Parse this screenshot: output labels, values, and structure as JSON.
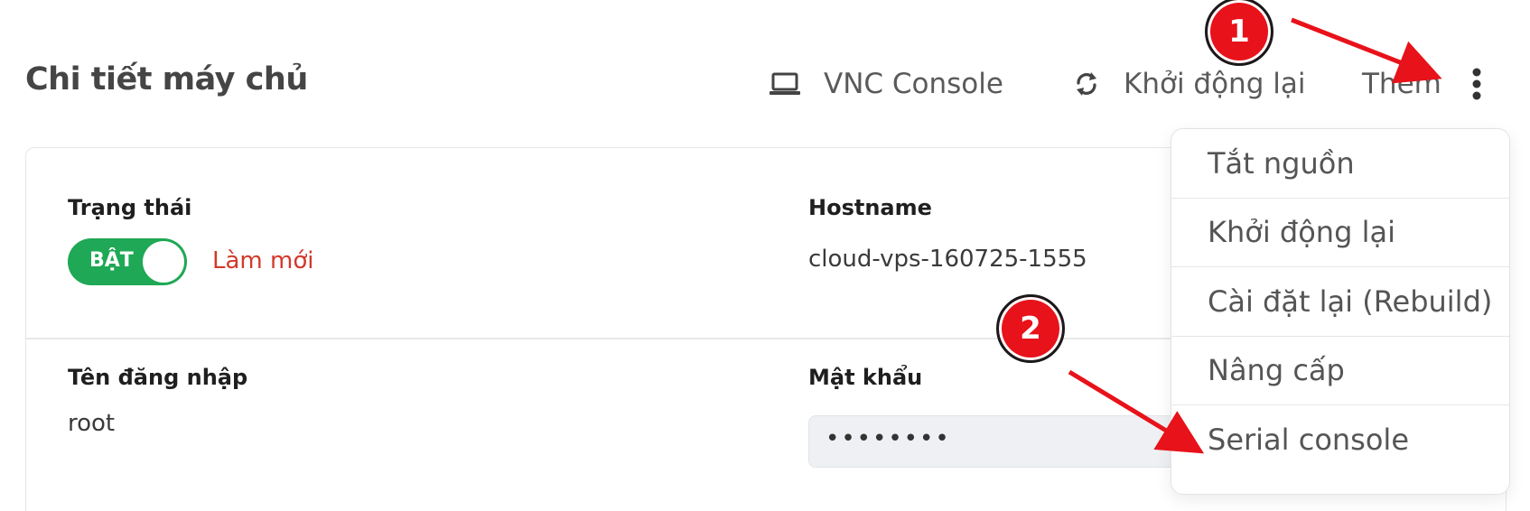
{
  "header": {
    "title": "Chi tiết máy chủ",
    "actions": {
      "vnc_label": "VNC Console",
      "restart_label": "Khởi động lại",
      "more_label": "Thêm"
    }
  },
  "details": {
    "status": {
      "label": "Trạng thái",
      "toggle_text": "BẬT",
      "toggle_on": true,
      "refresh_label": "Làm mới"
    },
    "hostname": {
      "label": "Hostname",
      "value": "cloud-vps-160725-1555"
    },
    "username": {
      "label": "Tên đăng nhập",
      "value": "root"
    },
    "password": {
      "label": "Mật khẩu",
      "masked": "••••••••"
    }
  },
  "dropdown": {
    "items": [
      "Tắt nguồn",
      "Khởi động lại",
      "Cài đặt lại (Rebuild)",
      "Nâng cấp",
      "Serial console"
    ]
  },
  "annotations": {
    "badge_1": "1",
    "badge_2": "2",
    "color": "#e8121a"
  },
  "colors": {
    "toggle_on": "#1fa855",
    "refresh_link": "#d23a2a"
  }
}
